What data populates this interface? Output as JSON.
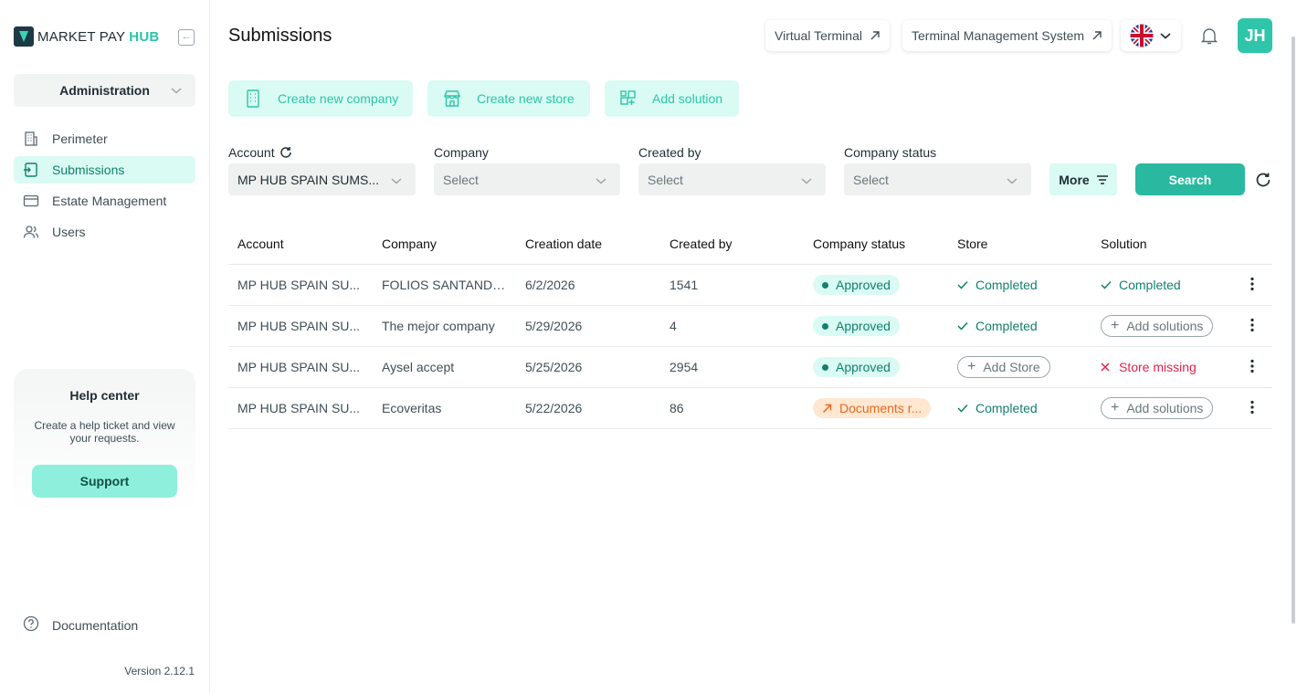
{
  "app": {
    "logo_text": "MARKET PAY",
    "logo_accent": "HUB",
    "version": "Version 2.12.1"
  },
  "sidebar": {
    "role": "Administration",
    "items": [
      {
        "label": "Perimeter",
        "icon": "building-icon"
      },
      {
        "label": "Submissions",
        "icon": "submissions-icon",
        "active": true
      },
      {
        "label": "Estate Management",
        "icon": "card-icon"
      },
      {
        "label": "Users",
        "icon": "users-icon"
      }
    ],
    "help": {
      "title": "Help center",
      "text": "Create a help ticket and view your requests.",
      "button": "Support"
    },
    "documentation": "Documentation"
  },
  "header": {
    "title": "Submissions",
    "links": [
      "Virtual Terminal",
      "Terminal Management System"
    ],
    "avatar": "JH"
  },
  "actions": [
    "Create new company",
    "Create new store",
    "Add solution"
  ],
  "filters": {
    "account": {
      "label": "Account",
      "value": "MP HUB SPAIN SUMS..."
    },
    "company": {
      "label": "Company",
      "placeholder": "Select"
    },
    "created_by": {
      "label": "Created by",
      "placeholder": "Select"
    },
    "company_status": {
      "label": "Company status",
      "placeholder": "Select"
    },
    "more": "More",
    "search": "Search"
  },
  "table": {
    "headers": [
      "Account",
      "Company",
      "Creation date",
      "Created by",
      "Company status",
      "Store",
      "Solution"
    ],
    "rows": [
      {
        "account": "MP HUB SPAIN SU...",
        "company": "FOLIOS SANTANDE...",
        "date": "6/2/2026",
        "created_by": "1541",
        "status": "Approved",
        "store": "Completed",
        "solution": "Completed"
      },
      {
        "account": "MP HUB SPAIN SU...",
        "company": "The mejor company",
        "date": "5/29/2026",
        "created_by": "4",
        "status": "Approved",
        "store": "Completed",
        "solution": "Add solutions"
      },
      {
        "account": "MP HUB SPAIN SU...",
        "company": "Aysel accept",
        "date": "5/25/2026",
        "created_by": "2954",
        "status": "Approved",
        "store": "Add Store",
        "solution": "Store missing"
      },
      {
        "account": "MP HUB SPAIN SU...",
        "company": "Ecoveritas",
        "date": "5/22/2026",
        "created_by": "86",
        "status": "Documents r...",
        "store": "Completed",
        "solution": "Add solutions"
      }
    ]
  },
  "colors": {
    "accent": "#2cc5a8",
    "accent_light": "#d9fbf3",
    "approved": "#12806d",
    "warning": "#e56b1f",
    "error": "#e0224d"
  }
}
